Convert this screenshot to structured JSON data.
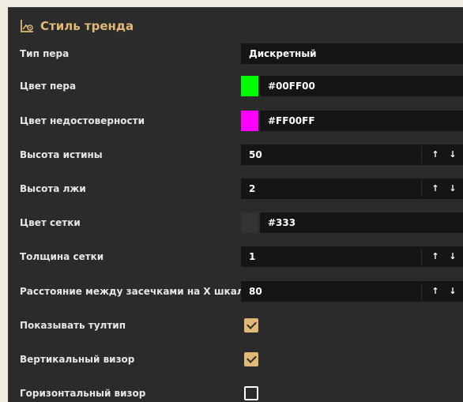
{
  "panel": {
    "title": "Стиль тренда",
    "title_icon": "chart-settings-icon"
  },
  "rows": {
    "pen_type": {
      "label": "Тип пера",
      "value": "Дискретный"
    },
    "pen_color": {
      "label": "Цвет пера",
      "value": "#00FF00",
      "swatch": "#00ff00"
    },
    "invalid_color": {
      "label": "Цвет недостоверности",
      "value": "#FF00FF",
      "swatch": "#ff00ff"
    },
    "true_height": {
      "label": "Высота истины",
      "value": "50"
    },
    "false_height": {
      "label": "Высота лжи",
      "value": "2"
    },
    "grid_color": {
      "label": "Цвет сетки",
      "value": "#333",
      "swatch": "#333333"
    },
    "grid_thickness": {
      "label": "Толщина сетки",
      "value": "1"
    },
    "tick_spacing": {
      "label": "Расстояние между засечками на X шкале",
      "value": "80"
    },
    "show_tooltip": {
      "label": "Показывать тултип",
      "checked": true
    },
    "vertical_viewer": {
      "label": "Вертикальный визор",
      "checked": true
    },
    "horizontal_viewer": {
      "label": "Горизонтальный визор",
      "checked": false
    }
  },
  "stepper": {
    "up": "↑",
    "down": "↓"
  },
  "colors": {
    "accent": "#e0b878",
    "panel_bg": "#2b2b2b",
    "field_bg": "#151515",
    "page_bg": "#f0ece2"
  }
}
